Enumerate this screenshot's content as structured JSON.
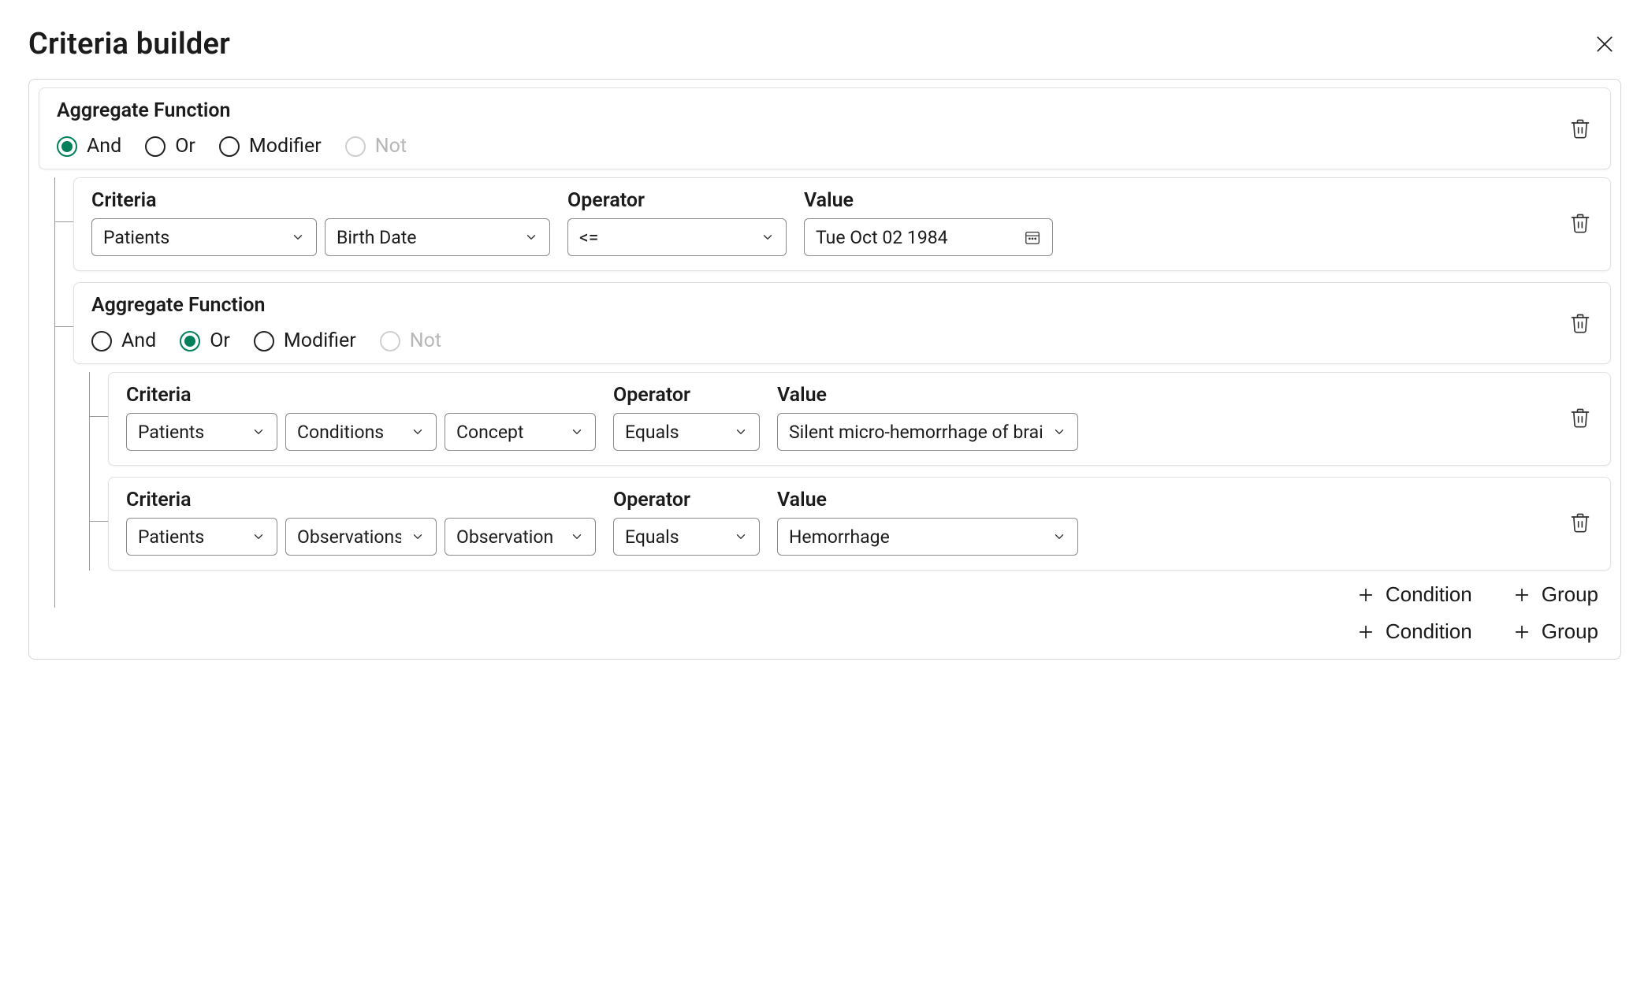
{
  "title": "Criteria builder",
  "labels": {
    "aggregate": "Aggregate Function",
    "criteria": "Criteria",
    "operator": "Operator",
    "value": "Value",
    "add_condition": "Condition",
    "add_group": "Group"
  },
  "radio_options": {
    "and": "And",
    "or": "Or",
    "modifier": "Modifier",
    "not": "Not"
  },
  "root_group": {
    "selected": "and",
    "disabled": [
      "not"
    ]
  },
  "root_condition": {
    "criteria_path": [
      "Patients",
      "Birth Date"
    ],
    "operator": "<=",
    "value": "Tue Oct 02 1984",
    "value_kind": "date"
  },
  "nested_group": {
    "selected": "or",
    "disabled": [
      "not"
    ]
  },
  "nested_conditions": [
    {
      "criteria_path": [
        "Patients",
        "Conditions",
        "Concept"
      ],
      "operator": "Equals",
      "value": "Silent micro-hemorrhage of brain"
    },
    {
      "criteria_path": [
        "Patients",
        "Observations",
        "Observation"
      ],
      "operator": "Equals",
      "value": "Hemorrhage"
    }
  ]
}
